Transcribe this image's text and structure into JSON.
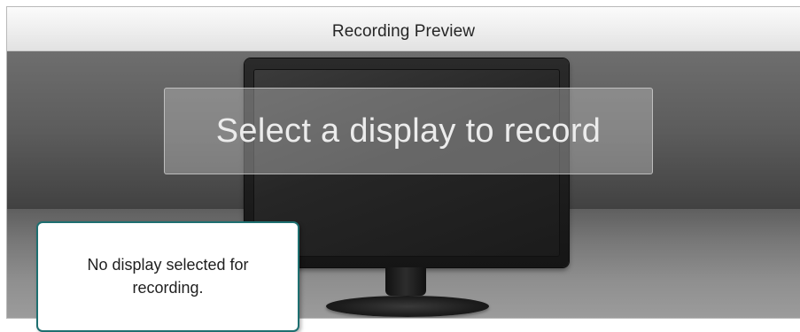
{
  "preview": {
    "title": "Recording Preview",
    "overlay_message": "Select a display to record"
  },
  "tooltip": {
    "text": "No display selected for recording."
  },
  "icons": {
    "monitor": "monitor-icon"
  },
  "colors": {
    "tooltip_border": "#1e6f70",
    "stage_background": "#5c5c5c",
    "title_bar": "#f0f0f0"
  }
}
